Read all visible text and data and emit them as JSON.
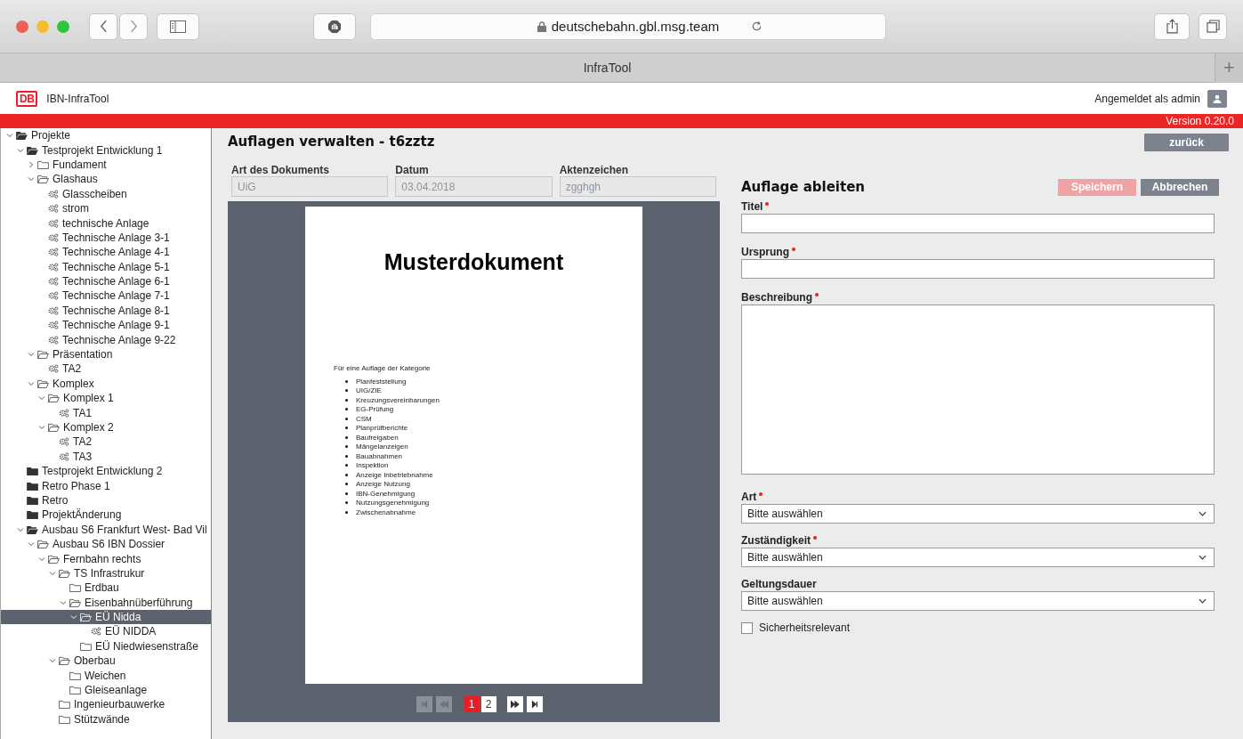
{
  "browser": {
    "url": "deutschebahn.gbl.msg.team",
    "tab_title": "InfraTool",
    "new_tab": "+"
  },
  "header": {
    "app_name": "IBN-InfraTool",
    "logo": "DB",
    "user": "Angemeldet als admin",
    "version": "Version 0.20.0"
  },
  "tree": [
    {
      "label": "Projekte",
      "kind": "project",
      "expanded": true,
      "selected": false,
      "children": [
        {
          "label": "Testprojekt Entwicklung 1",
          "kind": "project",
          "expanded": true,
          "selected": false,
          "children": [
            {
              "label": "Fundament",
              "kind": "folder",
              "expanded": false,
              "selected": false
            },
            {
              "label": "Glashaus",
              "kind": "folder",
              "expanded": true,
              "selected": false,
              "children": [
                {
                  "label": "Glasscheiben",
                  "kind": "asset",
                  "selected": false
                },
                {
                  "label": "strom",
                  "kind": "asset",
                  "selected": false
                },
                {
                  "label": "technische Anlage",
                  "kind": "asset",
                  "selected": false
                },
                {
                  "label": "Technische Anlage 3-1",
                  "kind": "asset",
                  "selected": false
                },
                {
                  "label": "Technische Anlage 4-1",
                  "kind": "asset",
                  "selected": false
                },
                {
                  "label": "Technische Anlage 5-1",
                  "kind": "asset",
                  "selected": false
                },
                {
                  "label": "Technische Anlage 6-1",
                  "kind": "asset",
                  "selected": false
                },
                {
                  "label": "Technische Anlage 7-1",
                  "kind": "asset",
                  "selected": false
                },
                {
                  "label": "Technische Anlage 8-1",
                  "kind": "asset",
                  "selected": false
                },
                {
                  "label": "Technische Anlage 9-1",
                  "kind": "asset",
                  "selected": false
                },
                {
                  "label": "Technische Anlage 9-22",
                  "kind": "asset",
                  "selected": false
                }
              ]
            },
            {
              "label": "Präsentation",
              "kind": "folder",
              "expanded": true,
              "selected": false,
              "children": [
                {
                  "label": "TA2",
                  "kind": "asset",
                  "selected": false
                }
              ]
            },
            {
              "label": "Komplex",
              "kind": "folder",
              "expanded": true,
              "selected": false,
              "children": [
                {
                  "label": "Komplex 1",
                  "kind": "folder",
                  "expanded": true,
                  "selected": false,
                  "children": [
                    {
                      "label": "TA1",
                      "kind": "asset",
                      "selected": false
                    }
                  ]
                },
                {
                  "label": "Komplex 2",
                  "kind": "folder",
                  "expanded": true,
                  "selected": false,
                  "children": [
                    {
                      "label": "TA2",
                      "kind": "asset",
                      "selected": false
                    },
                    {
                      "label": "TA3",
                      "kind": "asset",
                      "selected": false
                    }
                  ]
                }
              ]
            }
          ]
        },
        {
          "label": "Testprojekt Entwicklung 2",
          "kind": "project",
          "selected": false
        },
        {
          "label": "Retro Phase 1",
          "kind": "project",
          "selected": false
        },
        {
          "label": "Retro",
          "kind": "project",
          "selected": false
        },
        {
          "label": "ProjektÄnderung",
          "kind": "project",
          "selected": false
        },
        {
          "label": "Ausbau S6 Frankfurt West- Bad Vil",
          "kind": "project",
          "expanded": true,
          "selected": false,
          "children": [
            {
              "label": "Ausbau S6 IBN Dossier",
              "kind": "folder",
              "expanded": true,
              "selected": false,
              "children": [
                {
                  "label": "Fernbahn rechts",
                  "kind": "folder",
                  "expanded": true,
                  "selected": false,
                  "children": [
                    {
                      "label": "TS Infrastrukur",
                      "kind": "folder",
                      "expanded": true,
                      "selected": false,
                      "children": [
                        {
                          "label": "Erdbau",
                          "kind": "folder",
                          "selected": false
                        },
                        {
                          "label": "Eisenbahnüberführung",
                          "kind": "folder",
                          "expanded": true,
                          "selected": false,
                          "children": [
                            {
                              "label": "EÜ Nidda",
                              "kind": "folder",
                              "expanded": true,
                              "selected": true,
                              "children": [
                                {
                                  "label": "EÜ NIDDA",
                                  "kind": "asset",
                                  "selected": false
                                }
                              ]
                            },
                            {
                              "label": "EÜ Niedwiesenstraße",
                              "kind": "folder",
                              "selected": false
                            }
                          ]
                        }
                      ]
                    },
                    {
                      "label": "Oberbau",
                      "kind": "folder",
                      "expanded": true,
                      "selected": false,
                      "children": [
                        {
                          "label": "Weichen",
                          "kind": "folder",
                          "selected": false
                        },
                        {
                          "label": "Gleiseanlage",
                          "kind": "folder",
                          "selected": false
                        }
                      ]
                    },
                    {
                      "label": "Ingenieurbauwerke",
                      "kind": "folder",
                      "selected": false
                    },
                    {
                      "label": "Stützwände",
                      "kind": "folder",
                      "selected": false
                    }
                  ]
                }
              ]
            }
          ]
        }
      ]
    }
  ],
  "page": {
    "title": "Auflagen verwalten - t6zztz",
    "back_button": "zurück"
  },
  "document_fields": [
    {
      "label": "Art des Dokuments",
      "value": "UiG"
    },
    {
      "label": "Datum",
      "value": "03.04.2018"
    },
    {
      "label": "Aktenzeichen",
      "value": "zgghgh"
    }
  ],
  "document": {
    "heading": "Musterdokument",
    "intro": "Für eine Auflage der Kategorie",
    "items": [
      "Planfeststellung",
      "UIG/ZIE",
      "Kreuzungsvereinbarungen",
      "EG-Prüfung",
      "CSM",
      "Planprüfberichte",
      "Baufreigaben",
      "Mängelanzeigen",
      "Bauabnahmen",
      "Inspektion",
      "Anzeige Inbetriebnahme",
      "Anzeige Nutzung",
      "IBN-Genehmigung",
      "Nutzungsgenehmigung",
      "Zwischenabnahme"
    ]
  },
  "pagination": {
    "nav": [
      {
        "kind": "first",
        "disabled": true
      },
      {
        "kind": "prev",
        "disabled": true
      },
      {
        "kind": "next",
        "disabled": false
      },
      {
        "kind": "last",
        "disabled": false
      }
    ],
    "pages": [
      {
        "label": "1",
        "selected": true
      },
      {
        "label": "2",
        "selected": false
      }
    ]
  },
  "form": {
    "title": "Auflage ableiten",
    "buttons": [
      {
        "label": "Speichern",
        "kind": "primary",
        "disabled": true
      },
      {
        "label": "Abbrechen",
        "kind": "secondary",
        "disabled": false
      }
    ],
    "fields": [
      {
        "kind": "text",
        "label": "Titel",
        "required": true
      },
      {
        "kind": "text",
        "label": "Ursprung",
        "required": true
      },
      {
        "kind": "textarea",
        "label": "Beschreibung",
        "required": true
      },
      {
        "kind": "select",
        "label": "Art",
        "required": true,
        "value": "Bitte auswählen"
      },
      {
        "kind": "select",
        "label": "Zuständigkeit",
        "required": true,
        "value": "Bitte auswählen"
      },
      {
        "kind": "select",
        "label": "Geltungsdauer",
        "value": "Bitte auswählen"
      },
      {
        "kind": "checkbox",
        "label": "Sicherheitsrelevant",
        "checked": false
      }
    ]
  }
}
